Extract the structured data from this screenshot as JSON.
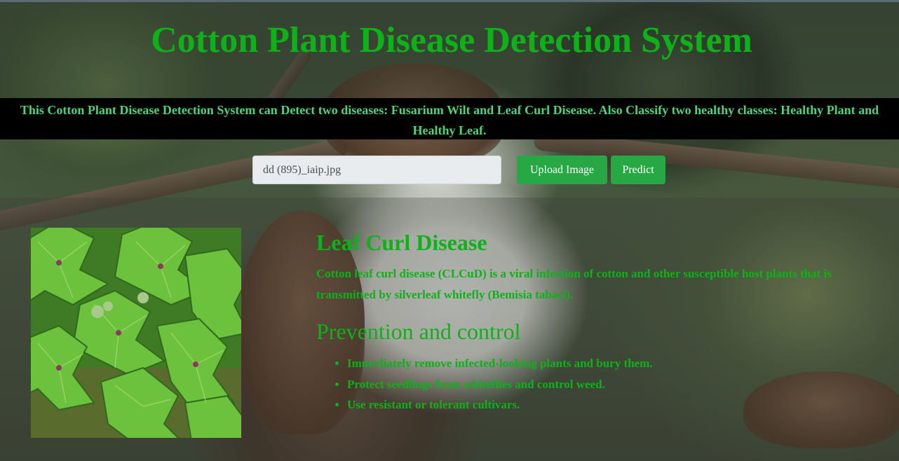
{
  "header": {
    "title": "Cotton Plant Disease Detection System",
    "banner": "This Cotton Plant Disease Detection System can Detect two diseases: Fusarium Wilt and Leaf Curl Disease. Also Classify two healthy classes: Healthy Plant and Healthy Leaf."
  },
  "upload": {
    "file_name": "dd (895)_iaip.jpg",
    "upload_label": "Upload Image",
    "predict_label": "Predict"
  },
  "result": {
    "disease_name": "Leaf Curl Disease",
    "description": "Cotton leaf curl disease (CLCuD) is a viral infection of cotton and other susceptible host plants that is transmitted by silverleaf whitefly (Bemisia tabaci).",
    "prevention_heading": "Prevention and control",
    "prevention_items": [
      "Immediately remove infected-looking plants and bury them.",
      "Protect seedlings from whiteflies and control weed.",
      "Use resistant or tolerant cultivars."
    ]
  },
  "colors": {
    "title_green": "#0db219",
    "banner_text": "#4fd37b",
    "banner_bg": "#000000",
    "button_green": "#28a745",
    "file_field_bg": "#e9ecef"
  }
}
